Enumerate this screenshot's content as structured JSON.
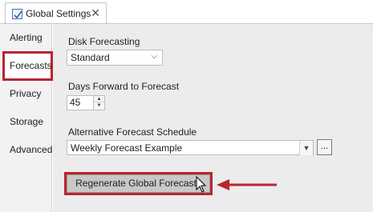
{
  "window": {
    "tab_title": "Global Settings",
    "close_glyph": "✕"
  },
  "sidebar": {
    "items": [
      {
        "label": "Alerting"
      },
      {
        "label": "Forecasts",
        "selected": true
      },
      {
        "label": "Privacy"
      },
      {
        "label": "Storage"
      },
      {
        "label": "Advanced"
      }
    ]
  },
  "form": {
    "disk_forecasting": {
      "label": "Disk Forecasting",
      "value": "Standard"
    },
    "days_forward": {
      "label": "Days Forward to Forecast",
      "value": "45"
    },
    "alt_schedule": {
      "label": "Alternative Forecast Schedule",
      "value": "Weekly Forecast Example",
      "browse_label": "..."
    },
    "regenerate_label": "Regenerate Global Forecasts"
  },
  "colors": {
    "highlight": "#b8262f",
    "panel_bg": "#ececec",
    "sidebar_bg": "#f2f2f2"
  }
}
